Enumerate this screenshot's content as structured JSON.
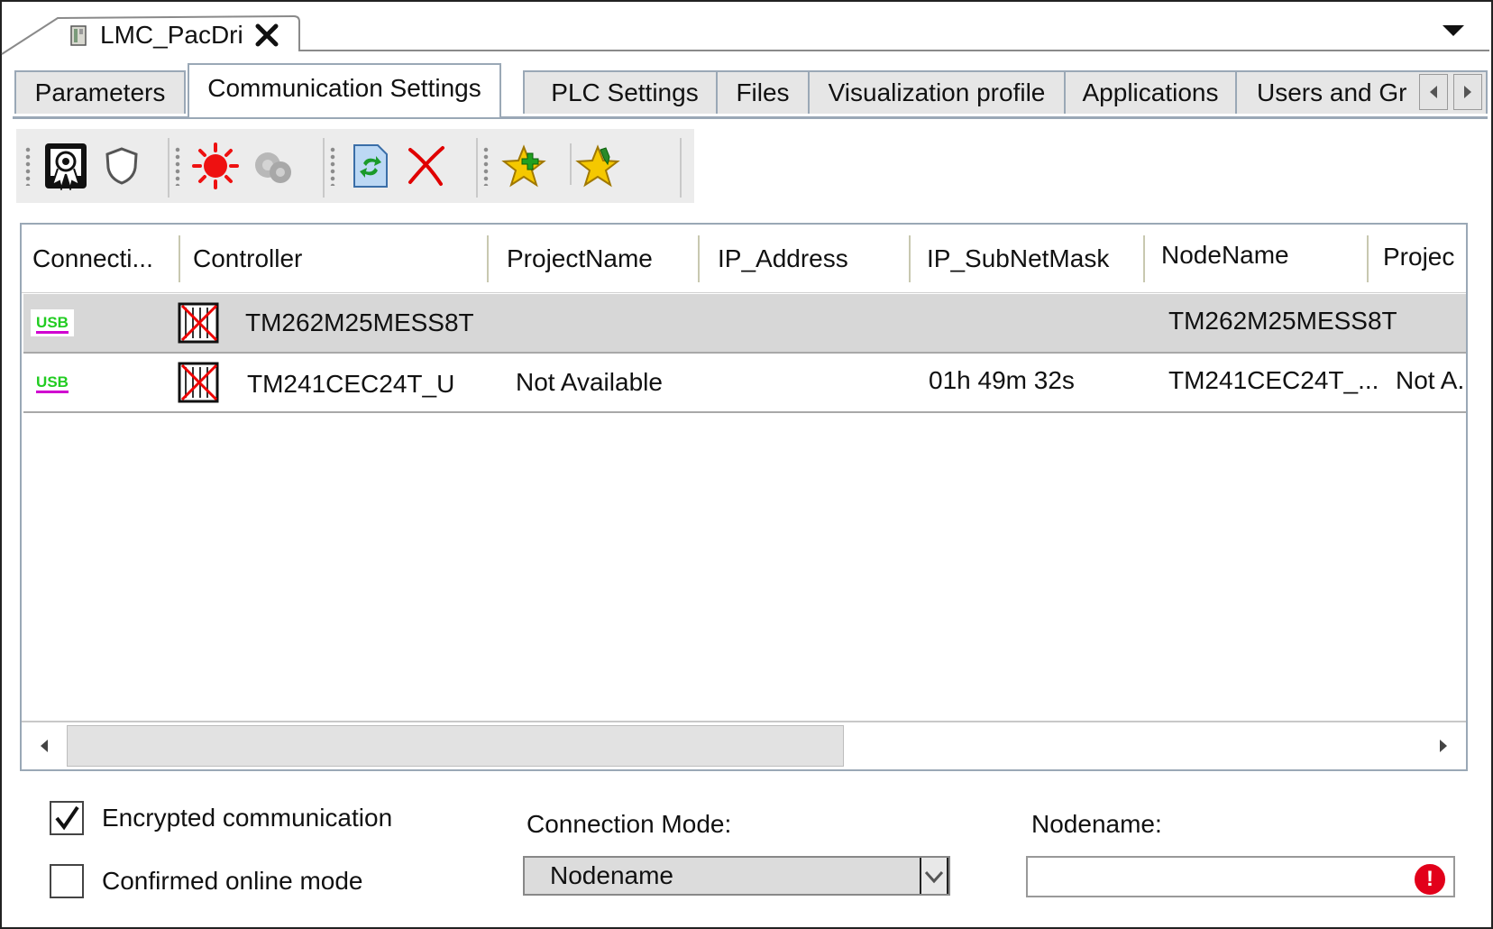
{
  "document_tab": {
    "title": "LMC_PacDri",
    "close_icon": "close-icon"
  },
  "tabs": [
    {
      "label": "Parameters"
    },
    {
      "label": "Communication Settings"
    },
    {
      "label": "PLC Settings"
    },
    {
      "label": "Files"
    },
    {
      "label": "Visualization profile"
    },
    {
      "label": "Applications"
    },
    {
      "label": "Users and Gr"
    }
  ],
  "active_tab": "Communication Settings",
  "toolbar": {
    "icons": [
      "certificate-icon",
      "shield-icon",
      "wink-icon",
      "gear-icon",
      "refresh-icon",
      "delete-icon",
      "add-favorite-icon",
      "edit-favorite-icon"
    ]
  },
  "table": {
    "columns": [
      "Connecti...",
      "Controller",
      "ProjectName",
      "IP_Address",
      "IP_SubNetMask",
      "NodeName",
      "Projec"
    ],
    "rows": [
      {
        "connection": "USB",
        "controller": "TM262M25MESS8T",
        "project": "",
        "ip": "",
        "subnet": "",
        "nodename": "TM262M25MESS8T",
        "projec": "",
        "selected": true
      },
      {
        "connection": "USB",
        "controller": "TM241CEC24T_U",
        "project": "Not Available",
        "ip": "",
        "subnet": "01h 49m 32s",
        "nodename": "TM241CEC24T_...",
        "projec": "Not A...",
        "selected": false
      }
    ]
  },
  "options": {
    "encrypted": {
      "label": "Encrypted communication",
      "checked": true
    },
    "confirmed": {
      "label": "Confirmed online mode",
      "checked": false
    }
  },
  "connection_mode": {
    "label": "Connection Mode:",
    "value": "Nodename"
  },
  "nodename_field": {
    "label": "Nodename:",
    "value": "",
    "error_glyph": "!"
  },
  "colors": {
    "tab_border": "#9aa8b6",
    "selected_row": "#d7d7d7",
    "error": "#e2001a",
    "usb_text": "#22cc22",
    "usb_underline": "#d000d0"
  }
}
